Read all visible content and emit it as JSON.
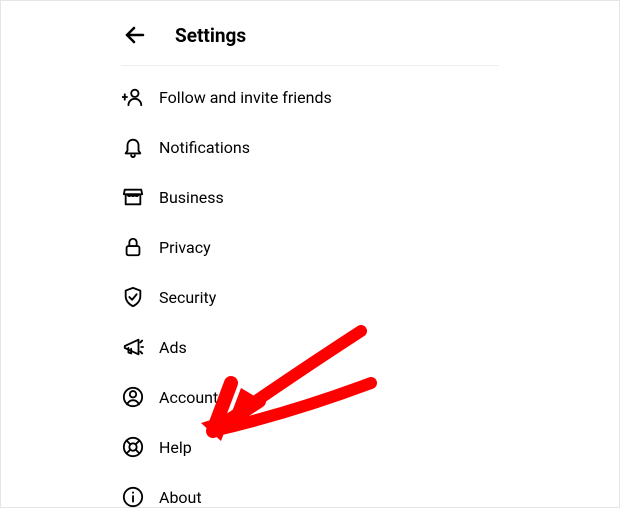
{
  "header": {
    "title": "Settings"
  },
  "menu": {
    "items": [
      {
        "id": "follow-invite",
        "label": "Follow and invite friends",
        "icon": "add-person-icon"
      },
      {
        "id": "notifications",
        "label": "Notifications",
        "icon": "bell-icon"
      },
      {
        "id": "business",
        "label": "Business",
        "icon": "storefront-icon"
      },
      {
        "id": "privacy",
        "label": "Privacy",
        "icon": "lock-icon"
      },
      {
        "id": "security",
        "label": "Security",
        "icon": "shield-check-icon"
      },
      {
        "id": "ads",
        "label": "Ads",
        "icon": "megaphone-icon"
      },
      {
        "id": "account",
        "label": "Account",
        "icon": "user-circle-icon"
      },
      {
        "id": "help",
        "label": "Help",
        "icon": "lifebuoy-icon"
      },
      {
        "id": "about",
        "label": "About",
        "icon": "info-circle-icon"
      }
    ]
  },
  "annotation": {
    "type": "hand-drawn-arrow",
    "color": "#ff0000",
    "points_to": "help"
  }
}
